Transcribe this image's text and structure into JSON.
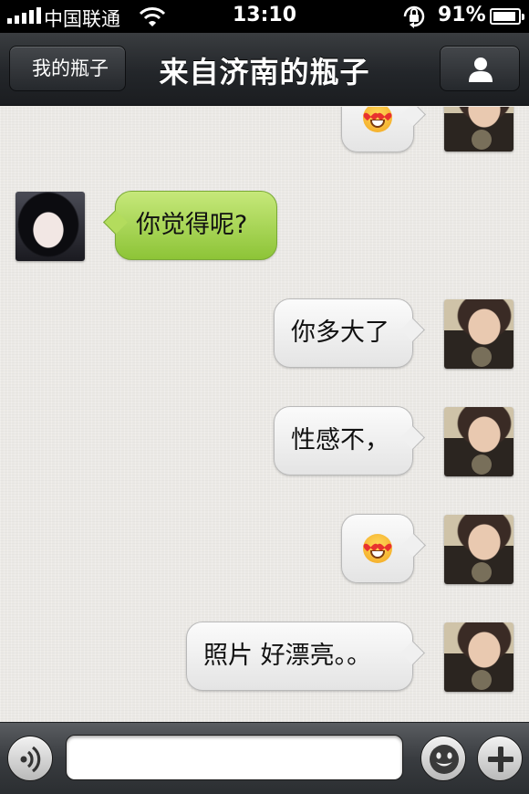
{
  "status_bar": {
    "carrier": "中国联通",
    "time": "13:10",
    "battery_percent": "91%",
    "battery_level": 0.91,
    "icons": [
      "signal-icon",
      "wifi-icon",
      "rotation-lock-icon",
      "battery-icon"
    ]
  },
  "nav": {
    "back_label": "我的瓶子",
    "title": "来自济南的瓶子",
    "profile_icon": "person-icon"
  },
  "messages": [
    {
      "sender": "self",
      "type": "emoji",
      "emoji": "heart-eyes-emoji"
    },
    {
      "sender": "other",
      "type": "text",
      "text": "你觉得呢?"
    },
    {
      "sender": "self",
      "type": "text",
      "text": "你多大了"
    },
    {
      "sender": "self",
      "type": "text",
      "text": "性感不，"
    },
    {
      "sender": "self",
      "type": "emoji",
      "emoji": "heart-eyes-emoji"
    },
    {
      "sender": "self",
      "type": "text",
      "text": "照片 好漂亮。。"
    }
  ],
  "input_bar": {
    "placeholder": "",
    "value": "",
    "left_icon": "voice-icon",
    "right_icons": [
      "smiley-icon",
      "plus-icon"
    ]
  },
  "colors": {
    "self_bubble": "#f2f2f2",
    "other_bubble": "#a9d65a",
    "nav_background": "#2a2d30"
  }
}
